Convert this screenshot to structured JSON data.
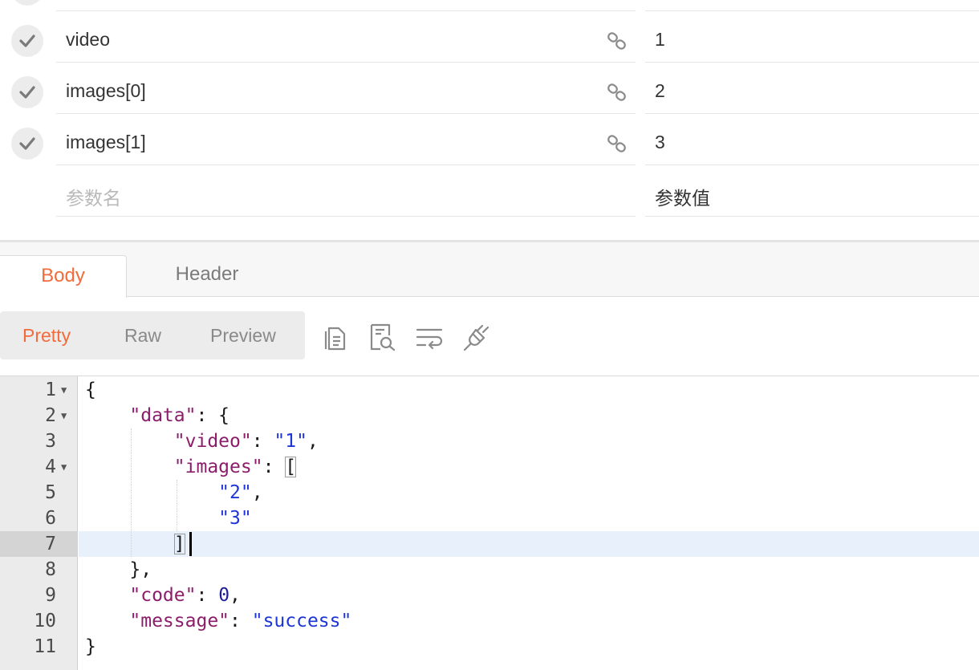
{
  "params": {
    "rows": [
      {
        "key": "video",
        "value": "1"
      },
      {
        "key": "images[0]",
        "value": "2"
      },
      {
        "key": "images[1]",
        "value": "3"
      }
    ],
    "key_placeholder": "参数名",
    "value_placeholder": "参数值"
  },
  "response": {
    "tabs": [
      "Body",
      "Header"
    ],
    "active_tab": "Body",
    "formats": [
      "Pretty",
      "Raw",
      "Preview"
    ],
    "active_format": "Pretty",
    "tools": [
      "copy-icon",
      "search-icon",
      "wrap-lines-icon",
      "link-off-icon"
    ]
  },
  "editor": {
    "active_line": "7",
    "lines": [
      {
        "n": "1",
        "folds": true
      },
      {
        "n": "2",
        "folds": true
      },
      {
        "n": "3",
        "folds": false
      },
      {
        "n": "4",
        "folds": true
      },
      {
        "n": "5",
        "folds": false
      },
      {
        "n": "6",
        "folds": false
      },
      {
        "n": "7",
        "folds": false
      },
      {
        "n": "8",
        "folds": false
      },
      {
        "n": "9",
        "folds": false
      },
      {
        "n": "10",
        "folds": false
      },
      {
        "n": "11",
        "folds": false
      }
    ],
    "json": {
      "data_key": "\"data\"",
      "video_key": "\"video\"",
      "video_val": "\"1\"",
      "images_key": "\"images\"",
      "img0": "\"2\"",
      "img1": "\"3\"",
      "code_key": "\"code\"",
      "code_val": "0",
      "message_key": "\"message\"",
      "message_val": "\"success\""
    }
  }
}
